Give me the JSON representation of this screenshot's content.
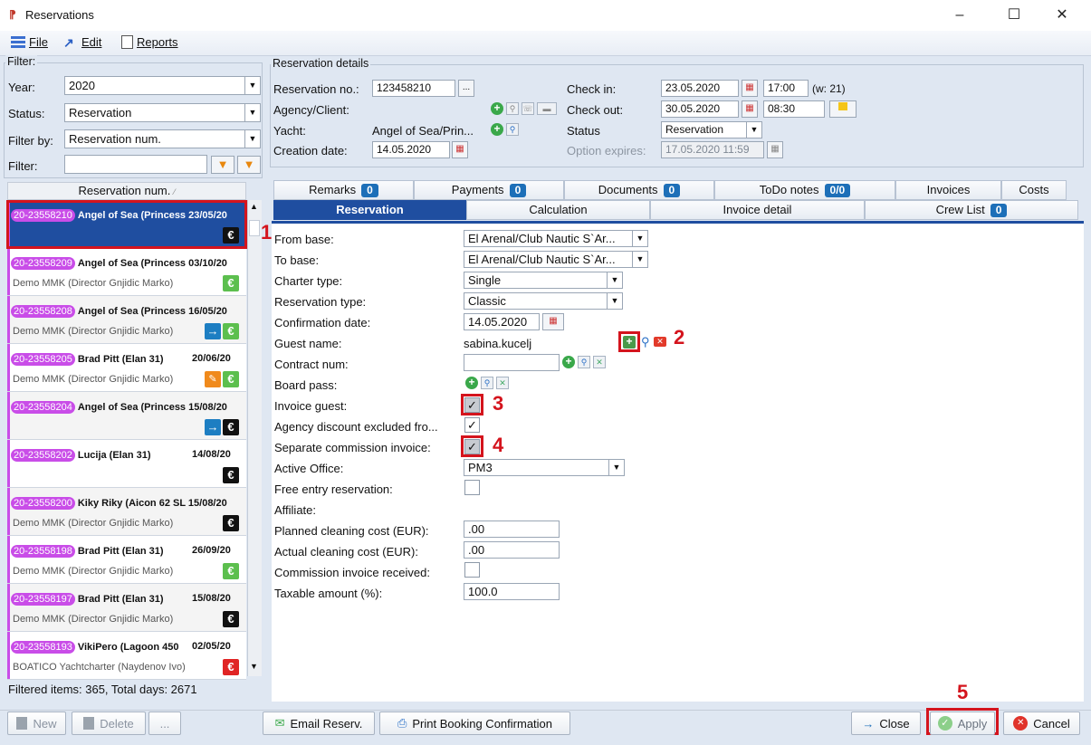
{
  "window": {
    "title": "Reservations",
    "minimize": "–",
    "maximize": "☐",
    "close": "✕"
  },
  "menu": {
    "file": "File",
    "edit": "Edit",
    "reports": "Reports"
  },
  "filter": {
    "legend": "Filter:",
    "year_label": "Year:",
    "year_value": "2020",
    "status_label": "Status:",
    "status_value": "Reservation",
    "filterby_label": "Filter by:",
    "filterby_value": "Reservation num.",
    "filter_label": "Filter:",
    "filter_value": ""
  },
  "list": {
    "header": "Reservation num.",
    "rows": [
      {
        "num": "20-23558210",
        "title": "Angel of Sea (Princess 23/05/20",
        "sub": "",
        "icons": [
          "euro-black"
        ]
      },
      {
        "num": "20-23558209",
        "title": "Angel of Sea (Princess 03/10/20",
        "sub": "Demo MMK (Director Gnjidic Marko)",
        "icons": [
          "euro-green"
        ]
      },
      {
        "num": "20-23558208",
        "title": "Angel of Sea (Princess 16/05/20",
        "sub": "Demo MMK (Director Gnjidic Marko)",
        "icons": [
          "arrow",
          "euro-green"
        ]
      },
      {
        "num": "20-23558205",
        "title": "Brad Pitt (Elan 31)",
        "date": "20/06/20",
        "sub": "Demo MMK (Director Gnjidic Marko)",
        "icons": [
          "pencil",
          "euro-green"
        ]
      },
      {
        "num": "20-23558204",
        "title": "Angel of Sea (Princess 15/08/20",
        "sub": "",
        "icons": [
          "arrow",
          "euro-black"
        ]
      },
      {
        "num": "20-23558202",
        "title": "Lucija (Elan 31)",
        "date": "14/08/20",
        "sub": "",
        "icons": [
          "euro-black"
        ]
      },
      {
        "num": "20-23558200",
        "title": "Kiky Riky (Aicon 62 SL 15/08/20",
        "sub": "Demo MMK (Director Gnjidic Marko)",
        "icons": [
          "euro-black"
        ]
      },
      {
        "num": "20-23558198",
        "title": "Brad Pitt (Elan 31)",
        "date": "26/09/20",
        "sub": "Demo MMK (Director Gnjidic Marko)",
        "icons": [
          "euro-green"
        ]
      },
      {
        "num": "20-23558197",
        "title": "Brad Pitt (Elan 31)",
        "date": "15/08/20",
        "sub": "Demo MMK (Director Gnjidic Marko)",
        "icons": [
          "euro-black"
        ]
      },
      {
        "num": "20-23558193",
        "title": "VikiPero (Lagoon 450",
        "date": "02/05/20",
        "sub": "BOATICO Yachtcharter (Naydenov Ivo)",
        "icons": [
          "euro-red"
        ]
      }
    ],
    "euro_symbol": "€",
    "arrow_symbol": "→",
    "pencil_symbol": "✎",
    "footer": "Filtered items: 365,  Total days: 2671"
  },
  "details": {
    "legend": "Reservation details",
    "resno_label": "Reservation no.:",
    "resno_value": "123458210",
    "resno_btn": "...",
    "agency_label": "Agency/Client:",
    "yacht_label": "Yacht:",
    "yacht_value": "Angel of Sea/Prin...",
    "creation_label": "Creation date:",
    "creation_value": "14.05.2020",
    "checkin_label": "Check in:",
    "checkin_date": "23.05.2020",
    "checkin_time": "17:00",
    "checkin_week": "(w: 21)",
    "checkout_label": "Check out:",
    "checkout_date": "30.05.2020",
    "checkout_time": "08:30",
    "status_label": "Status",
    "status_value": "Reservation",
    "option_label": "Option expires:",
    "option_value": "17.05.2020 11:59"
  },
  "tabs_top": [
    {
      "label": "Remarks",
      "badge": "0"
    },
    {
      "label": "Payments",
      "badge": "0"
    },
    {
      "label": "Documents",
      "badge": "0"
    },
    {
      "label": "ToDo notes",
      "badge": "0/0"
    },
    {
      "label": "Invoices",
      "badge": ""
    },
    {
      "label": "Costs",
      "badge": ""
    }
  ],
  "tabs_bottom": [
    {
      "label": "Reservation",
      "badge": ""
    },
    {
      "label": "Calculation",
      "badge": ""
    },
    {
      "label": "Invoice detail",
      "badge": ""
    },
    {
      "label": "Crew List",
      "badge": "0"
    }
  ],
  "form": {
    "from_base_label": "From base:",
    "from_base_value": "El Arenal/Club Nautic S`Ar...",
    "to_base_label": "To base:",
    "to_base_value": "El Arenal/Club Nautic S`Ar...",
    "charter_type_label": "Charter type:",
    "charter_type_value": "Single",
    "res_type_label": "Reservation type:",
    "res_type_value": "Classic",
    "confirm_date_label": "Confirmation date:",
    "confirm_date_value": "14.05.2020",
    "guest_label": "Guest name:",
    "guest_value": "sabina.kucelj",
    "contract_label": "Contract num:",
    "contract_value": "",
    "board_label": "Board pass:",
    "invoice_guest_label": "Invoice guest:",
    "invoice_guest_checked": "✓",
    "agency_discount_label": "Agency discount excluded fro...",
    "agency_discount_checked": "✓",
    "separate_comm_label": "Separate commission invoice:",
    "separate_comm_checked": "✓",
    "active_office_label": "Active Office:",
    "active_office_value": "PM3",
    "free_entry_label": "Free entry reservation:",
    "affiliate_label": "Affiliate:",
    "planned_clean_label": "Planned cleaning cost (EUR):",
    "planned_clean_value": ".00",
    "actual_clean_label": "Actual cleaning cost (EUR):",
    "actual_clean_value": ".00",
    "comm_received_label": "Commission invoice received:",
    "taxable_label": "Taxable amount (%):",
    "taxable_value": "100.0"
  },
  "annotations": {
    "n1": "1",
    "n2": "2",
    "n3": "3",
    "n4": "4",
    "n5": "5"
  },
  "buttons": {
    "new": "New",
    "delete": "Delete",
    "more": "...",
    "email": "Email Reserv.",
    "print": "Print Booking Confirmation",
    "close": "Close",
    "apply": "Apply",
    "cancel": "Cancel"
  },
  "colors": {
    "accent": "#1f4ea0",
    "highlight": "#d4141d",
    "res_badge": "#c94de8",
    "panel": "#dfe7f2"
  }
}
